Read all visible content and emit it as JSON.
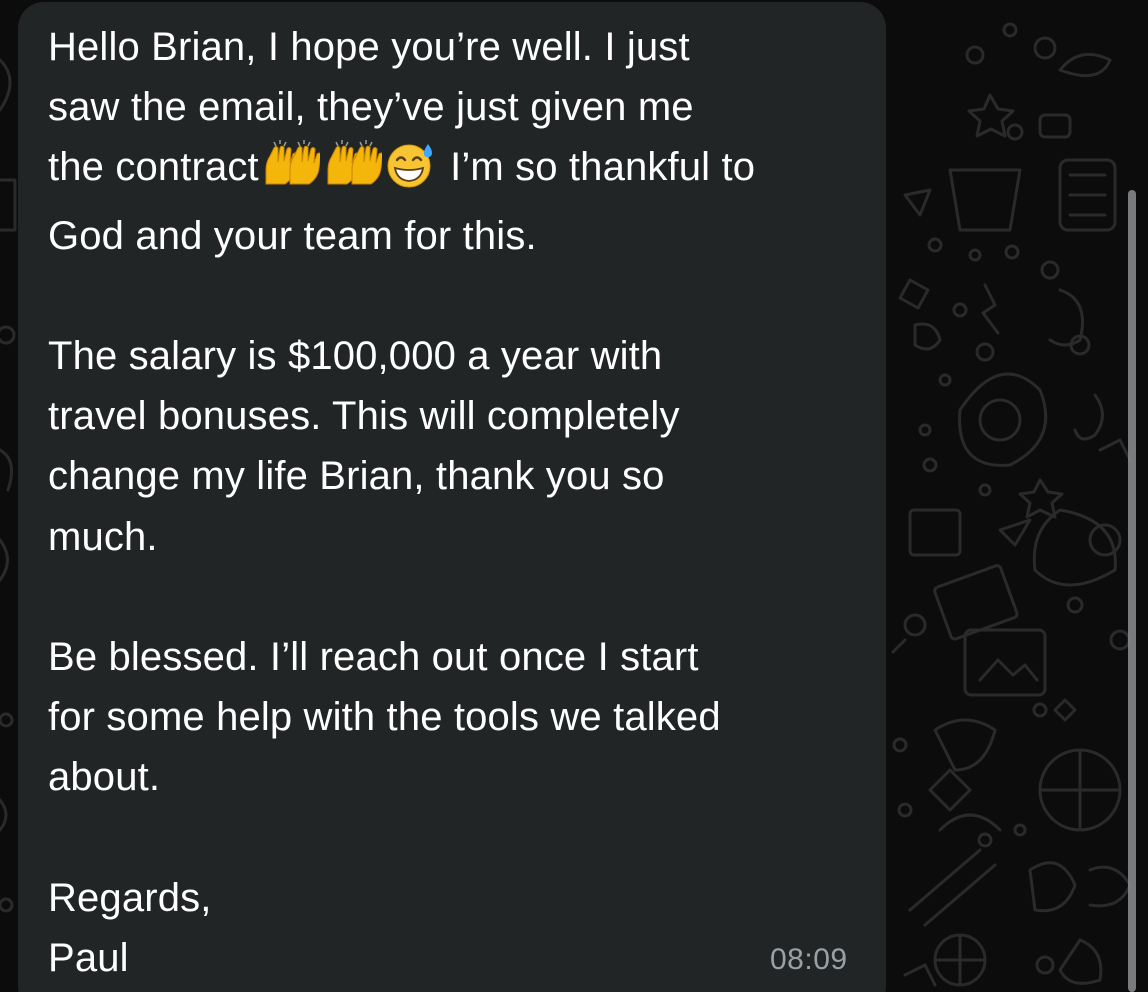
{
  "message": {
    "line_1": "Hello Brian, I hope you’re well. I just",
    "line_2": "saw the email, they’ve just given me",
    "line_3_before_emoji": "the contract",
    "line_3_after_emoji": " I’m so thankful to",
    "line_4": "God and your team for this.",
    "line_5": "The salary is $100,000 a year with",
    "line_6": "travel bonuses. This will completely",
    "line_7": "change my life Brian, thank you so",
    "line_8": "much.",
    "line_9": "Be blessed. I’ll reach out once I start",
    "line_10": "for some help with the tools we talked",
    "line_11": "about.",
    "line_12": "Regards,",
    "line_13": "Paul",
    "emojis": [
      "raising-hands-emoji",
      "raising-hands-emoji",
      "grinning-face-with-sweat-emoji"
    ],
    "time": "08:09"
  },
  "colors": {
    "background": "#0c0c0c",
    "bubble": "#222526",
    "text": "#ffffff",
    "timestamp": "#9aa0a3"
  }
}
